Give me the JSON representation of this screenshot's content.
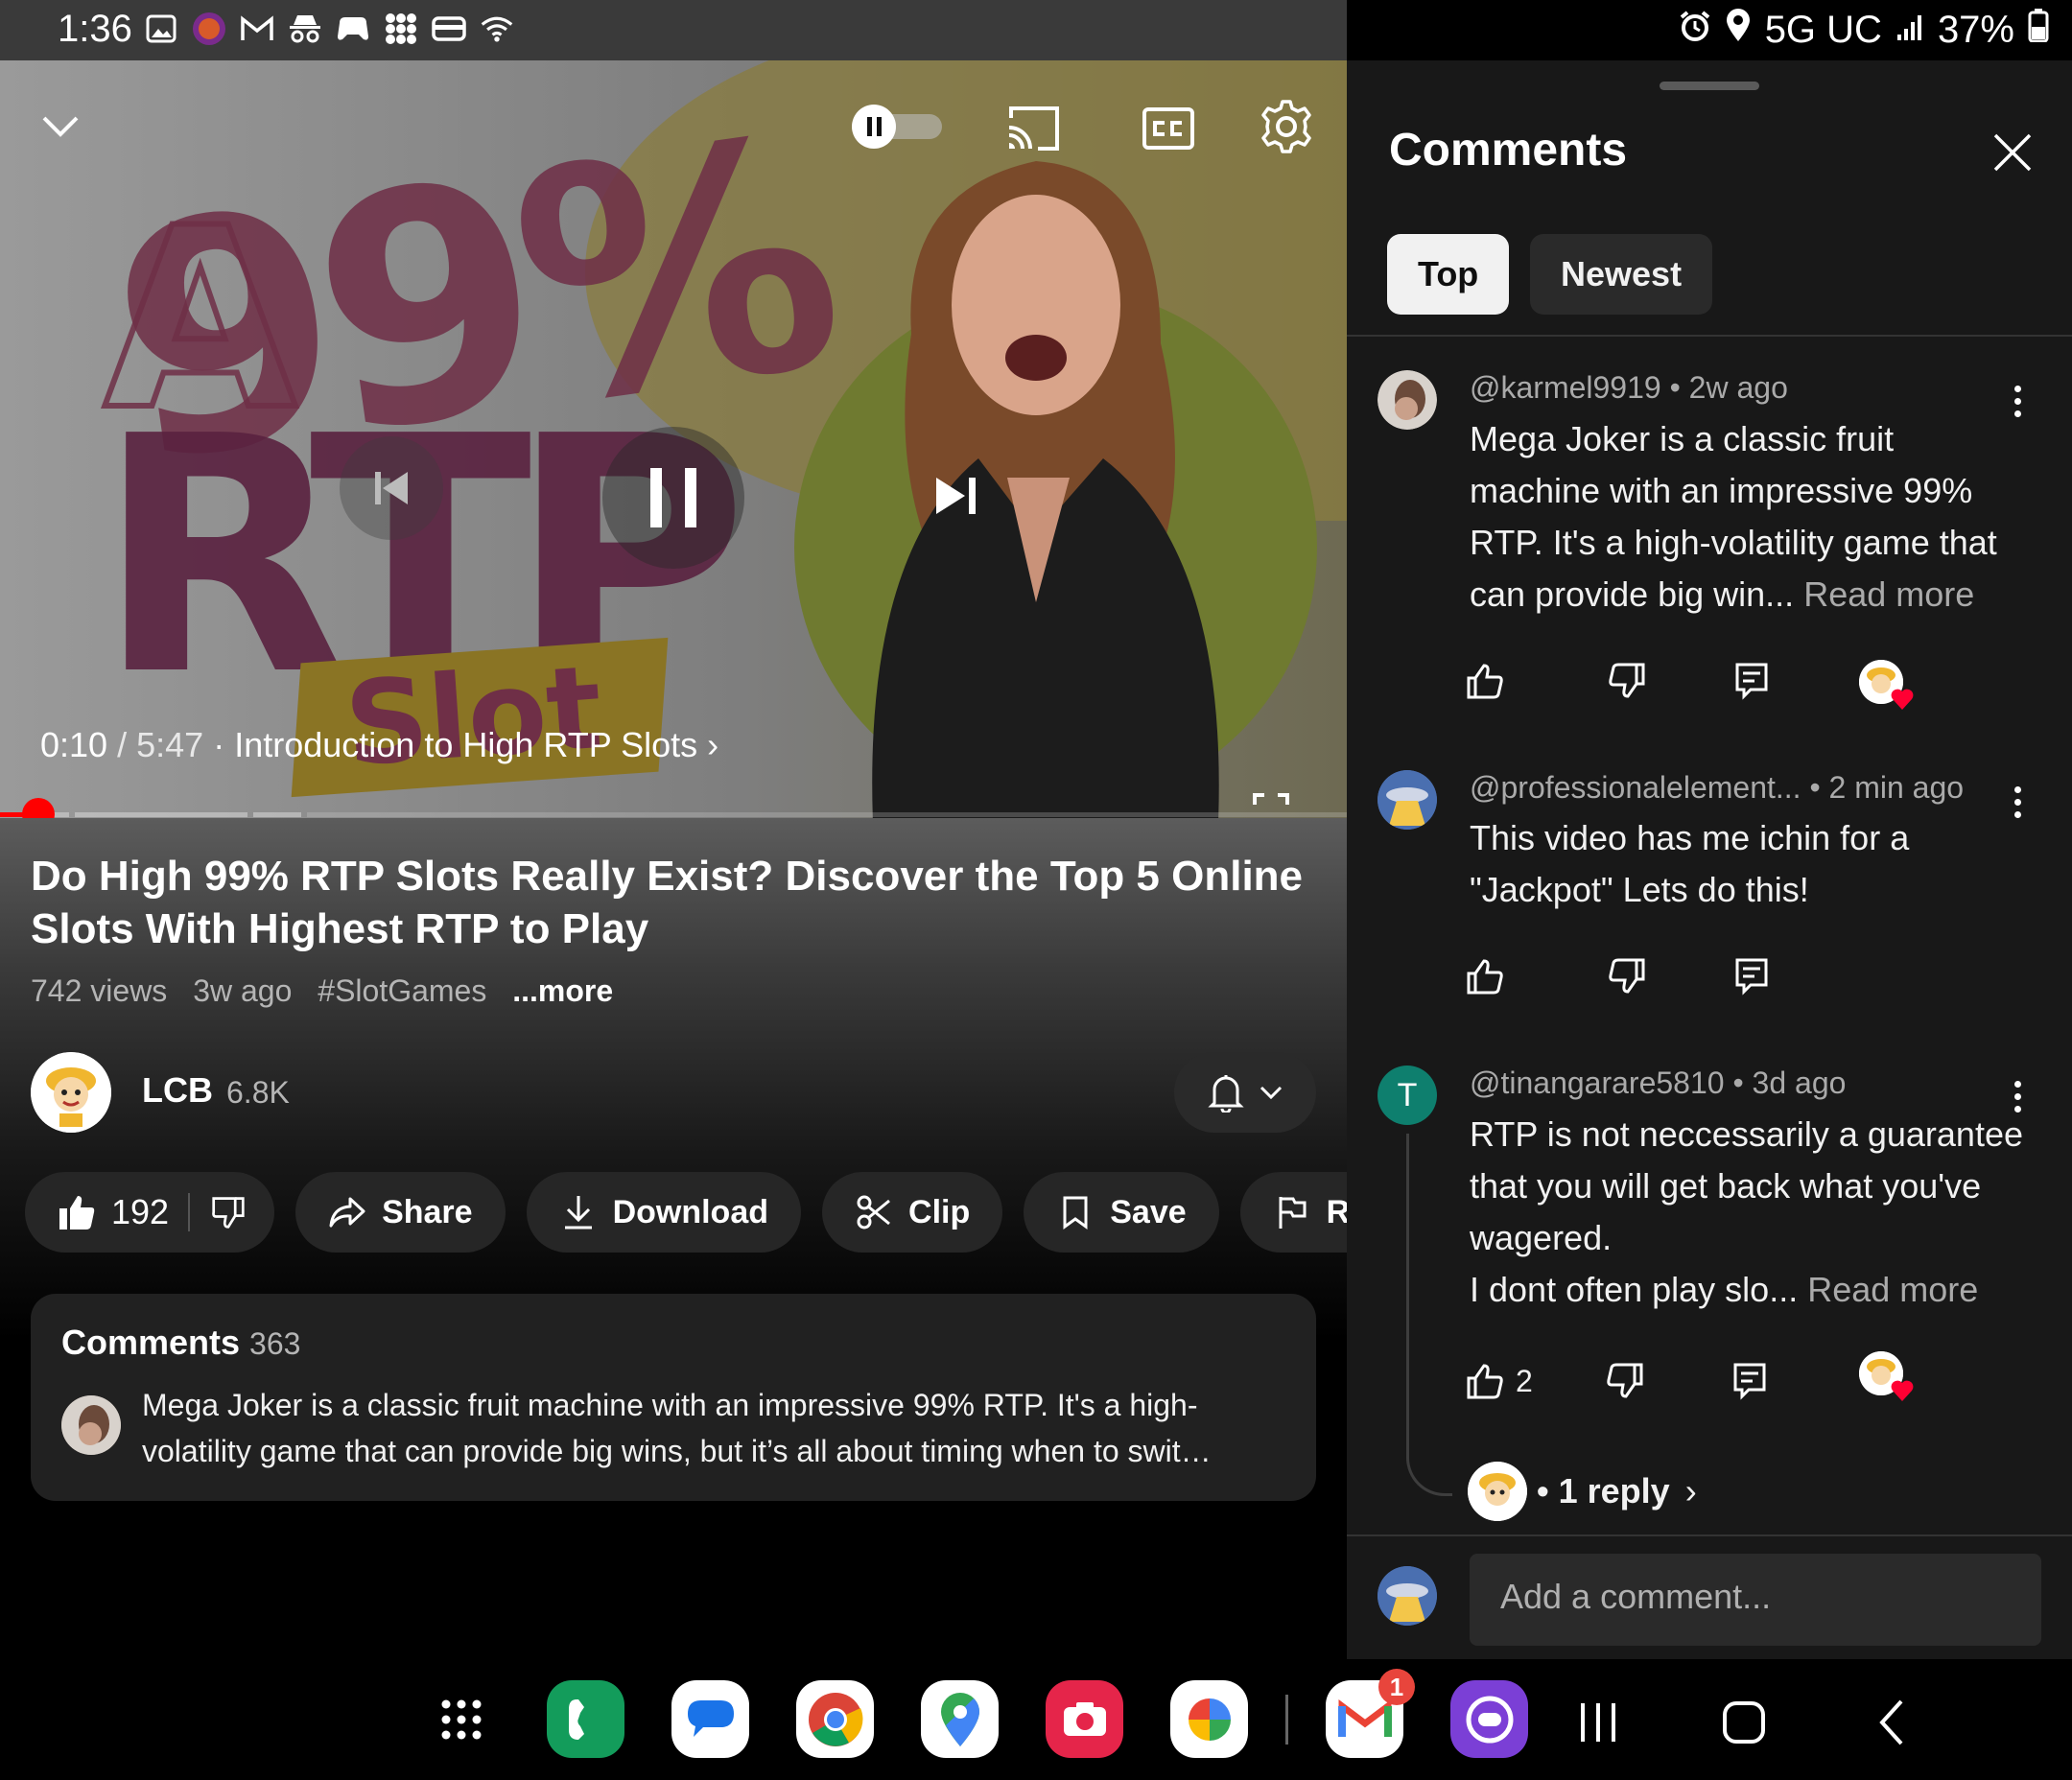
{
  "status_bar": {
    "time": "1:36",
    "network": "5G UC",
    "battery": "37%",
    "left_icons": [
      "gallery-icon",
      "bjs-app-icon",
      "gmail-icon",
      "incognito-icon",
      "game-controller-icon",
      "dots-grid-icon",
      "wallet-icon",
      "wifi-icon"
    ],
    "right_icons": [
      "alarm-icon",
      "location-icon",
      "signal-icon",
      "battery-icon"
    ]
  },
  "player": {
    "thumbnail_text": {
      "percent": "99%",
      "letter": "A",
      "rtp": "RTP",
      "slot": "Slot"
    },
    "time_current": "0:10",
    "time_separator": "/",
    "time_total": "5:47",
    "chapter": "· Introduction to High RTP Slots",
    "chapter_chevron": "›",
    "progress_fraction": 0.029,
    "icons": [
      "chevron-down-icon",
      "autoplay-toggle-icon",
      "cast-icon",
      "captions-icon",
      "settings-gear-icon",
      "previous-icon",
      "pause-icon",
      "next-icon",
      "fullscreen-icon"
    ]
  },
  "video": {
    "title": "Do High 99% RTP Slots Really Exist? Discover the Top 5 Online Slots With Highest RTP to Play",
    "views": "742 views",
    "age": "3w ago",
    "hashtag": "#SlotGames",
    "more": "...more"
  },
  "channel": {
    "name": "LCB",
    "subscribers": "6.8K"
  },
  "actions": {
    "likes": "192",
    "share": "Share",
    "download": "Download",
    "clip": "Clip",
    "save": "Save",
    "report": "Report"
  },
  "comments_preview": {
    "heading": "Comments",
    "count": "363",
    "text": "Mega Joker is a classic fruit machine with an impressive 99% RTP. It's a high-volatility game that can provide big wins, but it’s all about timing when to swit…"
  },
  "panel": {
    "title": "Comments",
    "chips": [
      "Top",
      "Newest"
    ],
    "selected_chip": "Top",
    "comments": [
      {
        "author": "@karmel9919",
        "time": "• 2w ago",
        "body": "Mega Joker is a classic fruit machine with an impressive 99% RTP. It's a high-volatility game that can provide big win...",
        "read_more": "Read more",
        "likes": "",
        "creator_hearted": true
      },
      {
        "author": "@professionalelement...",
        "time": "• 2 min ago",
        "body": "This video has me ichin for a \"Jackpot\" Lets do this!",
        "read_more": "",
        "likes": "",
        "creator_hearted": false
      },
      {
        "author": "@tinangarare5810",
        "time": "• 3d ago",
        "body": "RTP is not neccessarily a guarantee that you will get back what you've wagered.\nI dont often play slo...",
        "read_more": "Read more",
        "likes": "2",
        "creator_hearted": true,
        "avatar_letter": "T",
        "replies": "• 1 reply",
        "replies_chevron": "›"
      }
    ],
    "add_comment_placeholder": "Add a comment..."
  },
  "taskbar": {
    "apps": [
      "apps-grid-icon",
      "phone-app-icon",
      "messages-app-icon",
      "chrome-app-icon",
      "maps-app-icon",
      "camera-app-icon",
      "photos-app-icon",
      "gmail-app-icon",
      "chat-app-icon"
    ],
    "gmail_badge": "1",
    "nav": [
      "recents-icon",
      "home-icon",
      "back-icon"
    ]
  },
  "colors": {
    "accent_red": "#ff0000",
    "panel_bg": "#181818",
    "pill_bg": "#262626",
    "chip_selected": "#f1f1f1",
    "avatar_teal": "#0e7f6e"
  }
}
